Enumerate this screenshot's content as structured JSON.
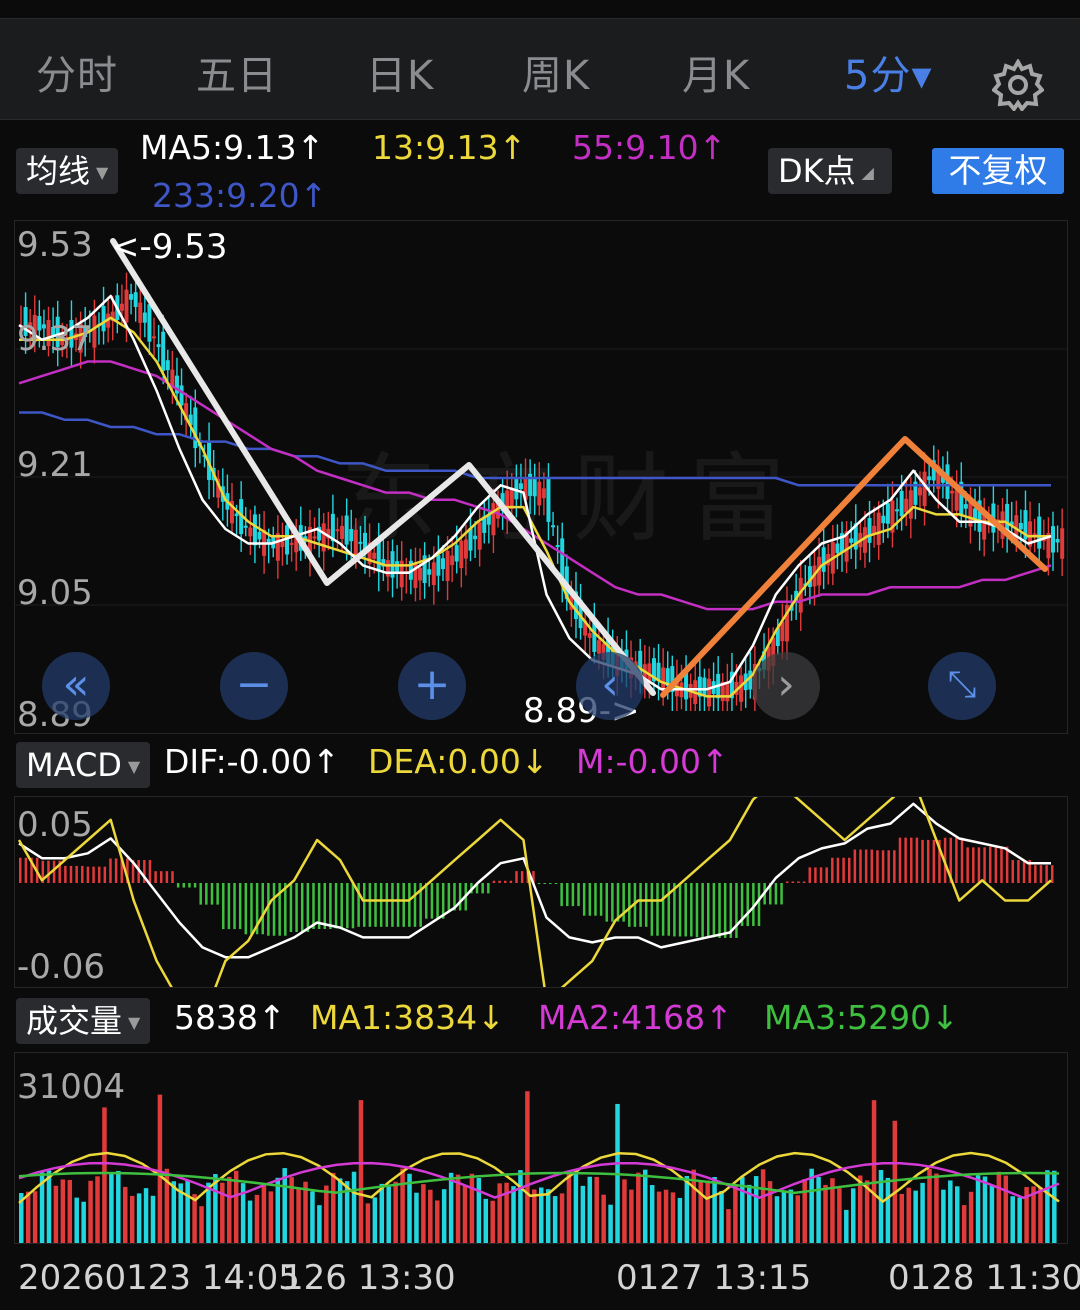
{
  "tabs": [
    "分时",
    "五日",
    "日K",
    "周K",
    "月K",
    "5分▾"
  ],
  "settings_icon": "gear-icon",
  "ma_panel": {
    "selector": "均线",
    "ma5": "MA5:9.13↑",
    "ma13": "13:9.13↑",
    "ma55": "55:9.10↑",
    "ma233": "233:9.20↑",
    "dk_button": "DK点",
    "fuquan_button": "不复权"
  },
  "price_axis": [
    "9.53",
    "9.37",
    "9.21",
    "9.05",
    "8.89"
  ],
  "price_high_label": "<-9.53",
  "price_low_label": "8.89->",
  "watermark": "东方财富",
  "controls": [
    "double-left-icon",
    "zoom-out-icon",
    "zoom-in-icon",
    "prev-icon",
    "next-icon",
    "fullscreen-icon"
  ],
  "macd_panel": {
    "selector": "MACD",
    "dif": "DIF:-0.00↑",
    "dea": "DEA:0.00↓",
    "m": "M:-0.00↑",
    "axis_top": "0.05",
    "axis_bottom": "-0.06"
  },
  "volume_panel": {
    "selector": "成交量",
    "value": "5838↑",
    "ma1": "MA1:3834↓",
    "ma2": "MA2:4168↑",
    "ma3": "MA3:5290↓",
    "axis_top": "31004"
  },
  "date_labels": [
    "20260123 14:05",
    "126 13:30",
    "0127 13:15",
    "0128 11:30"
  ],
  "colors": {
    "accent_blue": "#4a7fe6",
    "up_red": "#e03a3a",
    "down_cyan": "#22d6e0",
    "ma5_white": "#ffffff",
    "ma13_yellow": "#ecd83a",
    "ma55_magenta": "#c22fc2",
    "ma233_blue": "#3e56c6",
    "annotation_orange": "#f0813a"
  },
  "chart_data": {
    "type": "candlestick",
    "interval": "5分",
    "y_range": [
      8.89,
      9.53
    ],
    "high": 9.53,
    "low": 8.89,
    "ma5": [
      9.42,
      9.4,
      9.41,
      9.43,
      9.46,
      9.4,
      9.33,
      9.25,
      9.18,
      9.14,
      9.12,
      9.12,
      9.13,
      9.14,
      9.12,
      9.09,
      9.08,
      9.08,
      9.1,
      9.13,
      9.17,
      9.2,
      9.19,
      9.05,
      8.99,
      8.96,
      8.95,
      8.94,
      8.92,
      8.92,
      8.92,
      8.93,
      8.98,
      9.05,
      9.09,
      9.12,
      9.13,
      9.16,
      9.18,
      9.22,
      9.18,
      9.15,
      9.15,
      9.14,
      9.12,
      9.13
    ],
    "ma13": [
      9.4,
      9.4,
      9.4,
      9.41,
      9.43,
      9.41,
      9.37,
      9.31,
      9.25,
      9.18,
      9.15,
      9.13,
      9.13,
      9.12,
      9.11,
      9.1,
      9.09,
      9.09,
      9.1,
      9.12,
      9.15,
      9.17,
      9.17,
      9.11,
      9.04,
      9.0,
      8.97,
      8.95,
      8.93,
      8.92,
      8.91,
      8.91,
      8.94,
      9.0,
      9.05,
      9.09,
      9.11,
      9.13,
      9.14,
      9.17,
      9.16,
      9.16,
      9.15,
      9.15,
      9.13,
      9.13
    ],
    "ma55": [
      9.34,
      9.35,
      9.36,
      9.37,
      9.37,
      9.36,
      9.35,
      9.33,
      9.31,
      9.29,
      9.27,
      9.25,
      9.24,
      9.22,
      9.21,
      9.2,
      9.19,
      9.19,
      9.18,
      9.18,
      9.17,
      9.16,
      9.14,
      9.12,
      9.1,
      9.08,
      9.06,
      9.05,
      9.05,
      9.04,
      9.03,
      9.03,
      9.03,
      9.04,
      9.04,
      9.05,
      9.05,
      9.05,
      9.06,
      9.06,
      9.06,
      9.06,
      9.07,
      9.07,
      9.08,
      9.09
    ],
    "ma233": [
      9.3,
      9.3,
      9.29,
      9.29,
      9.28,
      9.28,
      9.27,
      9.27,
      9.26,
      9.26,
      9.25,
      9.25,
      9.24,
      9.24,
      9.23,
      9.23,
      9.22,
      9.22,
      9.22,
      9.22,
      9.21,
      9.21,
      9.21,
      9.21,
      9.21,
      9.21,
      9.21,
      9.21,
      9.21,
      9.21,
      9.21,
      9.21,
      9.21,
      9.21,
      9.2,
      9.2,
      9.2,
      9.2,
      9.2,
      9.2,
      9.2,
      9.2,
      9.2,
      9.2,
      9.2,
      9.2
    ]
  }
}
